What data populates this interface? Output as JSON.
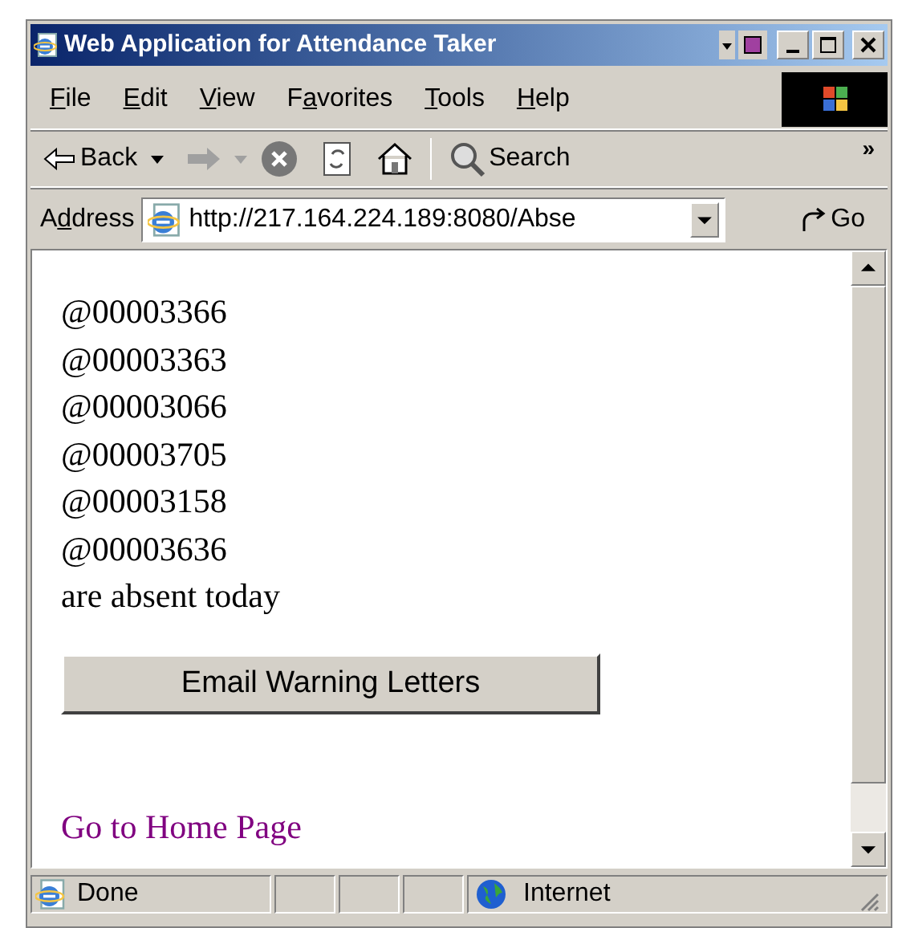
{
  "window": {
    "title": "Web Application for Attendance Taker"
  },
  "menu": [
    {
      "key": "F",
      "after": "ile"
    },
    {
      "key": "E",
      "after": "dit"
    },
    {
      "key": "V",
      "after": "iew"
    },
    {
      "before": "F",
      "key": "a",
      "after": "vorites"
    },
    {
      "key": "T",
      "after": "ools"
    },
    {
      "key": "H",
      "after": "elp"
    }
  ],
  "toolbar": {
    "back": "Back",
    "search": "Search",
    "more": "»"
  },
  "address": {
    "before": "A",
    "key": "d",
    "after": "dress",
    "value": "http://217.164.224.189:8080/Abse",
    "go": "Go"
  },
  "page": {
    "ids": [
      "@00003366",
      "@00003363",
      "@00003066",
      "@00003705",
      "@00003158",
      "@00003636"
    ],
    "message": "are absent today",
    "button": "Email Warning Letters",
    "link": "Go to Home Page"
  },
  "status": {
    "text": "Done",
    "zone": "Internet"
  }
}
